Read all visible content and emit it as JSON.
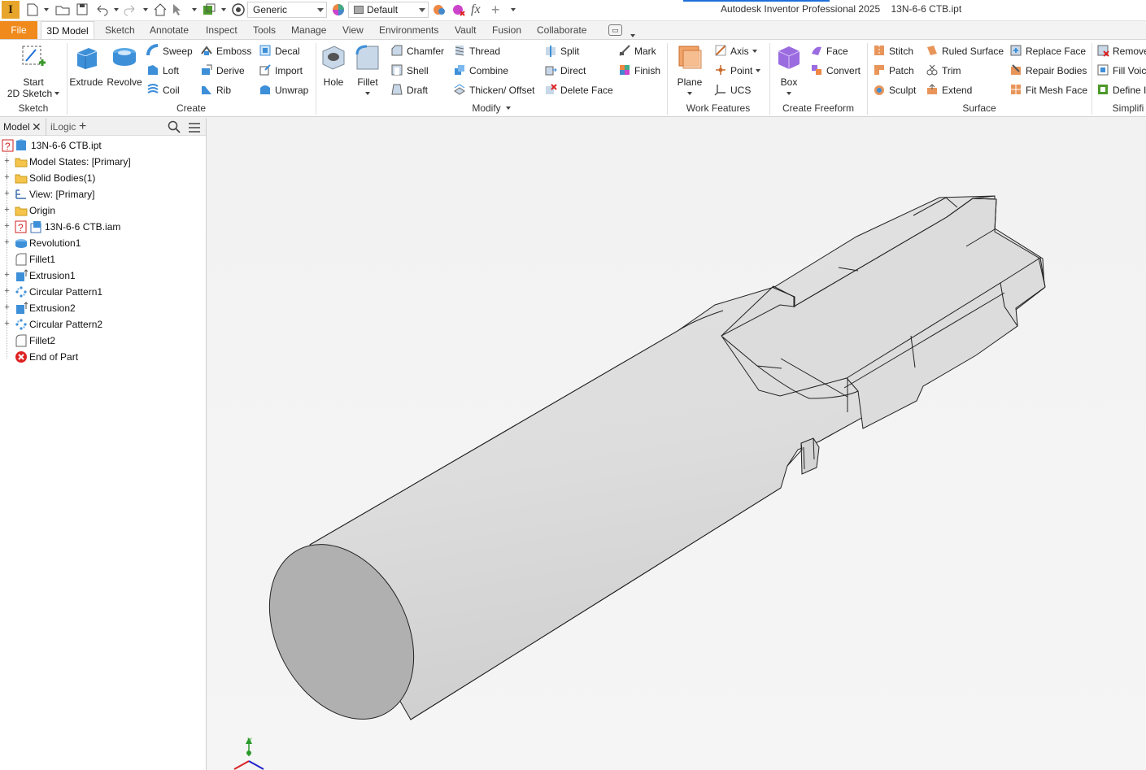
{
  "app": {
    "logo_letter": "I",
    "title": "Autodesk Inventor Professional 2025",
    "document": "13N-6-6 CTB.ipt",
    "appearance_combo": "Generic",
    "material_combo": "Default",
    "fx_label": "fx"
  },
  "tabs": [
    {
      "label": "File"
    },
    {
      "label": "3D Model"
    },
    {
      "label": "Sketch"
    },
    {
      "label": "Annotate"
    },
    {
      "label": "Inspect"
    },
    {
      "label": "Tools"
    },
    {
      "label": "Manage"
    },
    {
      "label": "View"
    },
    {
      "label": "Environments"
    },
    {
      "label": "Vault"
    },
    {
      "label": "Fusion"
    },
    {
      "label": "Collaborate"
    }
  ],
  "ribbon": {
    "sketch": {
      "title": "Sketch",
      "start": "Start",
      "start2": "2D Sketch"
    },
    "create": {
      "title": "Create",
      "extrude": "Extrude",
      "revolve": "Revolve",
      "sweep": "Sweep",
      "loft": "Loft",
      "coil": "Coil",
      "emboss": "Emboss",
      "derive": "Derive",
      "rib": "Rib",
      "decal": "Decal",
      "import": "Import",
      "unwrap": "Unwrap"
    },
    "modify": {
      "title": "Modify",
      "hole": "Hole",
      "fillet": "Fillet",
      "chamfer": "Chamfer",
      "shell": "Shell",
      "draft": "Draft",
      "thread": "Thread",
      "combine": "Combine",
      "thicken": "Thicken/ Offset",
      "split": "Split",
      "direct": "Direct",
      "delete_face": "Delete Face",
      "mark": "Mark",
      "finish": "Finish"
    },
    "work_features": {
      "title": "Work Features",
      "plane": "Plane",
      "axis": "Axis",
      "point": "Point",
      "ucs": "UCS"
    },
    "freeform": {
      "title": "Create Freeform",
      "box": "Box",
      "face": "Face",
      "convert": "Convert"
    },
    "surface": {
      "title": "Surface",
      "stitch": "Stitch",
      "patch": "Patch",
      "sculpt": "Sculpt",
      "ruled": "Ruled Surface",
      "trim": "Trim",
      "extend": "Extend",
      "replace": "Replace Face",
      "repair": "Repair Bodies",
      "fitmesh": "Fit Mesh Face"
    },
    "simplify": {
      "title": "Simplifi",
      "remove": "Remove",
      "fill": "Fill Voic",
      "define": "Define I"
    }
  },
  "browser": {
    "tab_model": "Model",
    "tab_ilogic": "iLogic",
    "items": [
      {
        "label": "13N-6-6 CTB.ipt",
        "icon": "part-icon"
      },
      {
        "label": "Model States: [Primary]",
        "icon": "folder-icon"
      },
      {
        "label": "Solid Bodies(1)",
        "icon": "folder-icon"
      },
      {
        "label": "View: [Primary]",
        "icon": "view-icon"
      },
      {
        "label": "Origin",
        "icon": "folder-icon"
      },
      {
        "label": "13N-6-6 CTB.iam",
        "icon": "assembly-icon"
      },
      {
        "label": "Revolution1",
        "icon": "revolve-icon"
      },
      {
        "label": "Fillet1",
        "icon": "fillet-icon"
      },
      {
        "label": "Extrusion1",
        "icon": "extrude-icon"
      },
      {
        "label": "Circular Pattern1",
        "icon": "pattern-icon"
      },
      {
        "label": "Extrusion2",
        "icon": "extrude-icon"
      },
      {
        "label": "Circular Pattern2",
        "icon": "pattern-icon"
      },
      {
        "label": "Fillet2",
        "icon": "fillet-icon"
      },
      {
        "label": "End of Part",
        "icon": "end-of-part-icon"
      }
    ]
  },
  "viewport": {
    "triad_y_label": "Y"
  }
}
